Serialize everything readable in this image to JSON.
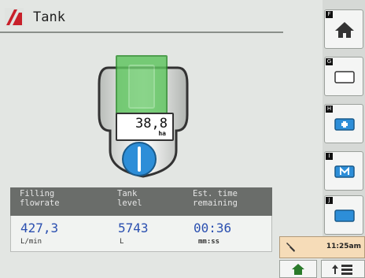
{
  "header": {
    "title": "Tank"
  },
  "tank": {
    "display_value": "38,8",
    "display_unit": "ha",
    "fill_color": "#5ec55e"
  },
  "info_panel": {
    "headers": [
      {
        "line1": "Filling",
        "line2": "flowrate"
      },
      {
        "line1": "Tank",
        "line2": "level"
      },
      {
        "line1": "Est. time",
        "line2": "remaining"
      }
    ],
    "values": [
      {
        "value": "427,3",
        "unit": "L/min"
      },
      {
        "value": "5743",
        "unit": "L"
      },
      {
        "value": "00:36",
        "unit": "mm:ss"
      }
    ]
  },
  "softkeys": [
    {
      "tag": "F",
      "icon": "home-icon"
    },
    {
      "tag": "G",
      "icon": "blank-screen-icon"
    },
    {
      "tag": "H",
      "icon": "plus-screen-icon"
    },
    {
      "tag": "I",
      "icon": "m-screen-icon"
    },
    {
      "tag": "J",
      "icon": "blue-screen-icon"
    }
  ],
  "status_bar": {
    "time": "11:25am"
  },
  "colors": {
    "accent_blue": "#2d8ed8",
    "value_blue": "#2a4fb0",
    "status_bg": "#f6dcb8"
  }
}
